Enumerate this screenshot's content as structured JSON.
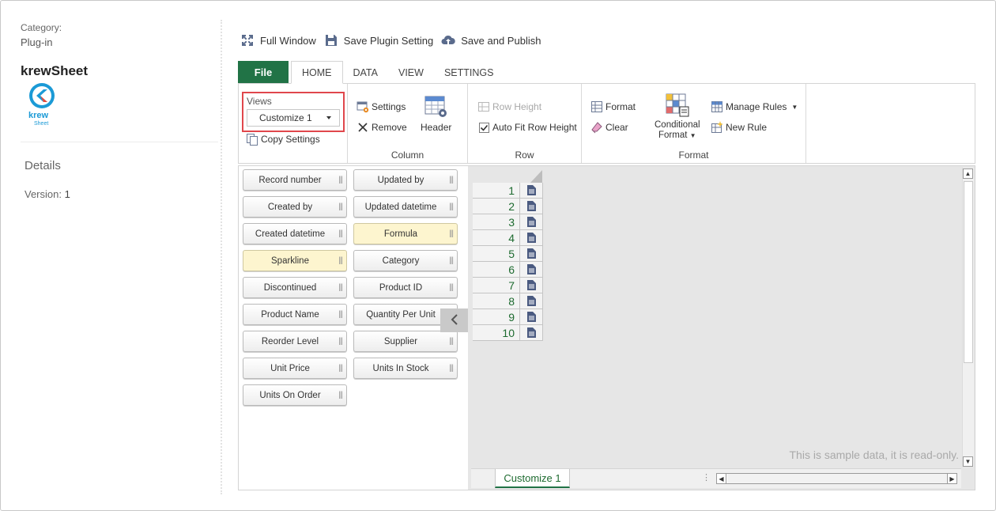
{
  "side": {
    "category_label": "Category:",
    "category_value": "Plug-in",
    "app_name": "krewSheet",
    "logo_text": "krew",
    "logo_subtext": "Sheet",
    "details_heading": "Details",
    "version_label": "Version:",
    "version_value": "1"
  },
  "toolbar": {
    "full_window": "Full Window",
    "save_plugin": "Save Plugin Setting",
    "save_publish": "Save and Publish"
  },
  "tabs": {
    "file": "File",
    "home": "HOME",
    "data": "DATA",
    "view": "VIEW",
    "settings": "SETTINGS"
  },
  "ribbon": {
    "views_label": "Views",
    "views_selected": "Customize 1",
    "copy_settings": "Copy Settings",
    "column": {
      "settings": "Settings",
      "remove": "Remove",
      "header": "Header",
      "group_label": "Column"
    },
    "row": {
      "row_height": "Row Height",
      "auto_fit": "Auto Fit Row Height",
      "group_label": "Row"
    },
    "format": {
      "format": "Format",
      "clear": "Clear",
      "conditional_line1": "Conditional",
      "conditional_line2": "Format",
      "manage_rules": "Manage Rules",
      "new_rule": "New Rule",
      "group_label": "Format"
    }
  },
  "fields": {
    "left": [
      {
        "label": "Record number",
        "highlight": false
      },
      {
        "label": "Created by",
        "highlight": false
      },
      {
        "label": "Created datetime",
        "highlight": false
      },
      {
        "label": "Sparkline",
        "highlight": true
      },
      {
        "label": "Discontinued",
        "highlight": false
      },
      {
        "label": "Product Name",
        "highlight": false
      },
      {
        "label": "Reorder Level",
        "highlight": false
      },
      {
        "label": "Unit Price",
        "highlight": false
      },
      {
        "label": "Units On Order",
        "highlight": false
      }
    ],
    "right": [
      {
        "label": "Updated by",
        "highlight": false
      },
      {
        "label": "Updated datetime",
        "highlight": false
      },
      {
        "label": "Formula",
        "highlight": true
      },
      {
        "label": "Category",
        "highlight": false
      },
      {
        "label": "Product ID",
        "highlight": false
      },
      {
        "label": "Quantity Per Unit",
        "highlight": false
      },
      {
        "label": "Supplier",
        "highlight": false
      },
      {
        "label": "Units In Stock",
        "highlight": false
      }
    ]
  },
  "sheet": {
    "rows": [
      "1",
      "2",
      "3",
      "4",
      "5",
      "6",
      "7",
      "8",
      "9",
      "10"
    ],
    "sample_note": "This is sample data, it is read-only.",
    "sheet_tab": "Customize 1"
  },
  "colors": {
    "file_tab": "#217346",
    "highlight_field": "#fdf5cf",
    "views_border": "#e0474c",
    "row_number": "#1e6b30"
  }
}
